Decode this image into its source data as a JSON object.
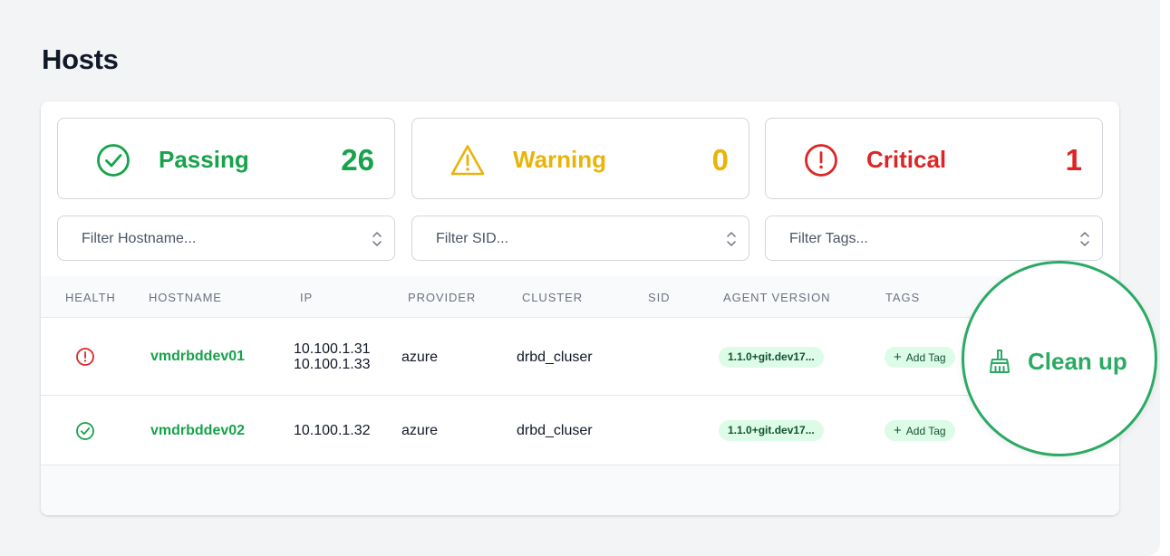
{
  "page": {
    "title": "Hosts"
  },
  "colors": {
    "passing": "#16a34a",
    "warning": "#eab308",
    "critical": "#dc2626",
    "accent": "#2aaa64",
    "pill_bg": "#dcfce7"
  },
  "summary": {
    "passing": {
      "label": "Passing",
      "count": "26",
      "icon": "check-circle-icon"
    },
    "warning": {
      "label": "Warning",
      "count": "0",
      "icon": "warning-triangle-icon"
    },
    "critical": {
      "label": "Critical",
      "count": "1",
      "icon": "exclamation-circle-icon"
    }
  },
  "filters": {
    "hostname": {
      "placeholder": "Filter Hostname..."
    },
    "sid": {
      "placeholder": "Filter SID..."
    },
    "tags": {
      "placeholder": "Filter Tags..."
    }
  },
  "table": {
    "columns": [
      "Health",
      "Hostname",
      "IP",
      "Provider",
      "Cluster",
      "SID",
      "Agent Version",
      "Tags"
    ],
    "rows": [
      {
        "health": "critical",
        "health_icon": "exclamation-circle-icon",
        "hostname": "vmdrbddev01",
        "ips": [
          "10.100.1.31",
          "10.100.1.33"
        ],
        "provider": "azure",
        "cluster": "drbd_cluser",
        "sid": "",
        "agent_version": "1.1.0+git.dev17...",
        "add_tag_label": "Add Tag"
      },
      {
        "health": "passing",
        "health_icon": "check-circle-icon",
        "hostname": "vmdrbddev02",
        "ips": [
          "10.100.1.32"
        ],
        "provider": "azure",
        "cluster": "drbd_cluser",
        "sid": "",
        "agent_version": "1.1.0+git.dev17...",
        "add_tag_label": "Add Tag"
      }
    ]
  },
  "cleanup": {
    "label": "Clean up",
    "icon": "broom-icon"
  }
}
